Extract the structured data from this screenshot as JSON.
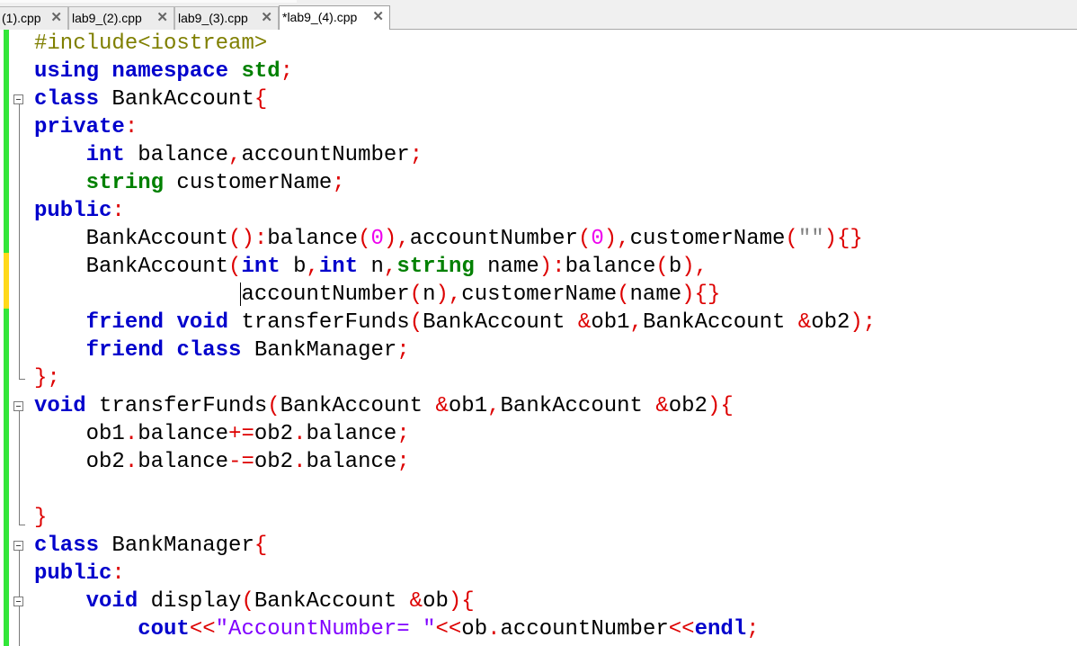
{
  "tabs": [
    {
      "label": "(1).cpp",
      "active": false
    },
    {
      "label": "lab9_(2).cpp",
      "active": false
    },
    {
      "label": "lab9_(3).cpp",
      "active": false
    },
    {
      "label": "*lab9_(4).cpp",
      "active": true
    }
  ],
  "close_glyph": "✕",
  "code": {
    "l1": "#include<iostream>",
    "l2_kw1": "using",
    "l2_kw2": "namespace",
    "l2_ns": "std",
    "l2_semi": ";",
    "l3_kw": "class",
    "l3_name": " BankAccount",
    "l3_brace": "{",
    "l4_kw": "private",
    "l4_colon": ":",
    "l5_kw": "int",
    "l5_a": " balance",
    "l5_comma": ",",
    "l5_b": "accountNumber",
    "l5_semi": ";",
    "l6_kw": "string",
    "l6_a": " customerName",
    "l6_semi": ";",
    "l7_kw": "public",
    "l7_colon": ":",
    "l8_a": "BankAccount",
    "l8_p1": "():",
    "l8_b": "balance",
    "l8_p2": "(",
    "l8_n1": "0",
    "l8_p3": "),",
    "l8_c": "accountNumber",
    "l8_p4": "(",
    "l8_n2": "0",
    "l8_p5": "),",
    "l8_d": "customerName",
    "l8_p6": "(",
    "l8_str": "\"\"",
    "l8_p7": "){}",
    "l9_a": "BankAccount",
    "l9_p1": "(",
    "l9_kw1": "int",
    "l9_b": " b",
    "l9_p2": ",",
    "l9_kw2": "int",
    "l9_c": " n",
    "l9_p3": ",",
    "l9_kw3": "string",
    "l9_d": " name",
    "l9_p4": "):",
    "l9_e": "balance",
    "l9_p5": "(",
    "l9_f": "b",
    "l9_p6": "),",
    "l10_a": "accountNumber",
    "l10_p1": "(",
    "l10_b": "n",
    "l10_p2": "),",
    "l10_c": "customerName",
    "l10_p3": "(",
    "l10_d": "name",
    "l10_p4": "){}",
    "l11_kw1": "friend",
    "l11_kw2": "void",
    "l11_a": " transferFunds",
    "l11_p1": "(",
    "l11_b": "BankAccount ",
    "l11_p2": "&",
    "l11_c": "ob1",
    "l11_p3": ",",
    "l11_d": "BankAccount ",
    "l11_p4": "&",
    "l11_e": "ob2",
    "l11_p5": ");",
    "l12_kw1": "friend",
    "l12_kw2": "class",
    "l12_a": " BankManager",
    "l12_semi": ";",
    "l13": "};",
    "l14_kw": "void",
    "l14_a": " transferFunds",
    "l14_p1": "(",
    "l14_b": "BankAccount ",
    "l14_p2": "&",
    "l14_c": "ob1",
    "l14_p3": ",",
    "l14_d": "BankAccount ",
    "l14_p4": "&",
    "l14_e": "ob2",
    "l14_p5": "){",
    "l15_a": "ob1",
    "l15_p1": ".",
    "l15_b": "balance",
    "l15_p2": "+=",
    "l15_c": "ob2",
    "l15_p3": ".",
    "l15_d": "balance",
    "l15_p4": ";",
    "l16_a": "ob2",
    "l16_p1": ".",
    "l16_b": "balance",
    "l16_p2": "-=",
    "l16_c": "ob2",
    "l16_p3": ".",
    "l16_d": "balance",
    "l16_p4": ";",
    "l18": "}",
    "l19_kw": "class",
    "l19_name": " BankManager",
    "l19_brace": "{",
    "l20_kw": "public",
    "l20_colon": ":",
    "l21_kw": "void",
    "l21_a": " display",
    "l21_p1": "(",
    "l21_b": "BankAccount ",
    "l21_p2": "&",
    "l21_c": "ob",
    "l21_p3": "){",
    "l22_kw": "cout",
    "l22_p1": "<<",
    "l22_str": "\"AccountNumber= \"",
    "l22_p2": "<<",
    "l22_a": "ob",
    "l22_p3": ".",
    "l22_b": "accountNumber",
    "l22_p4": "<<",
    "l22_kw2": "endl",
    "l22_p5": ";"
  }
}
